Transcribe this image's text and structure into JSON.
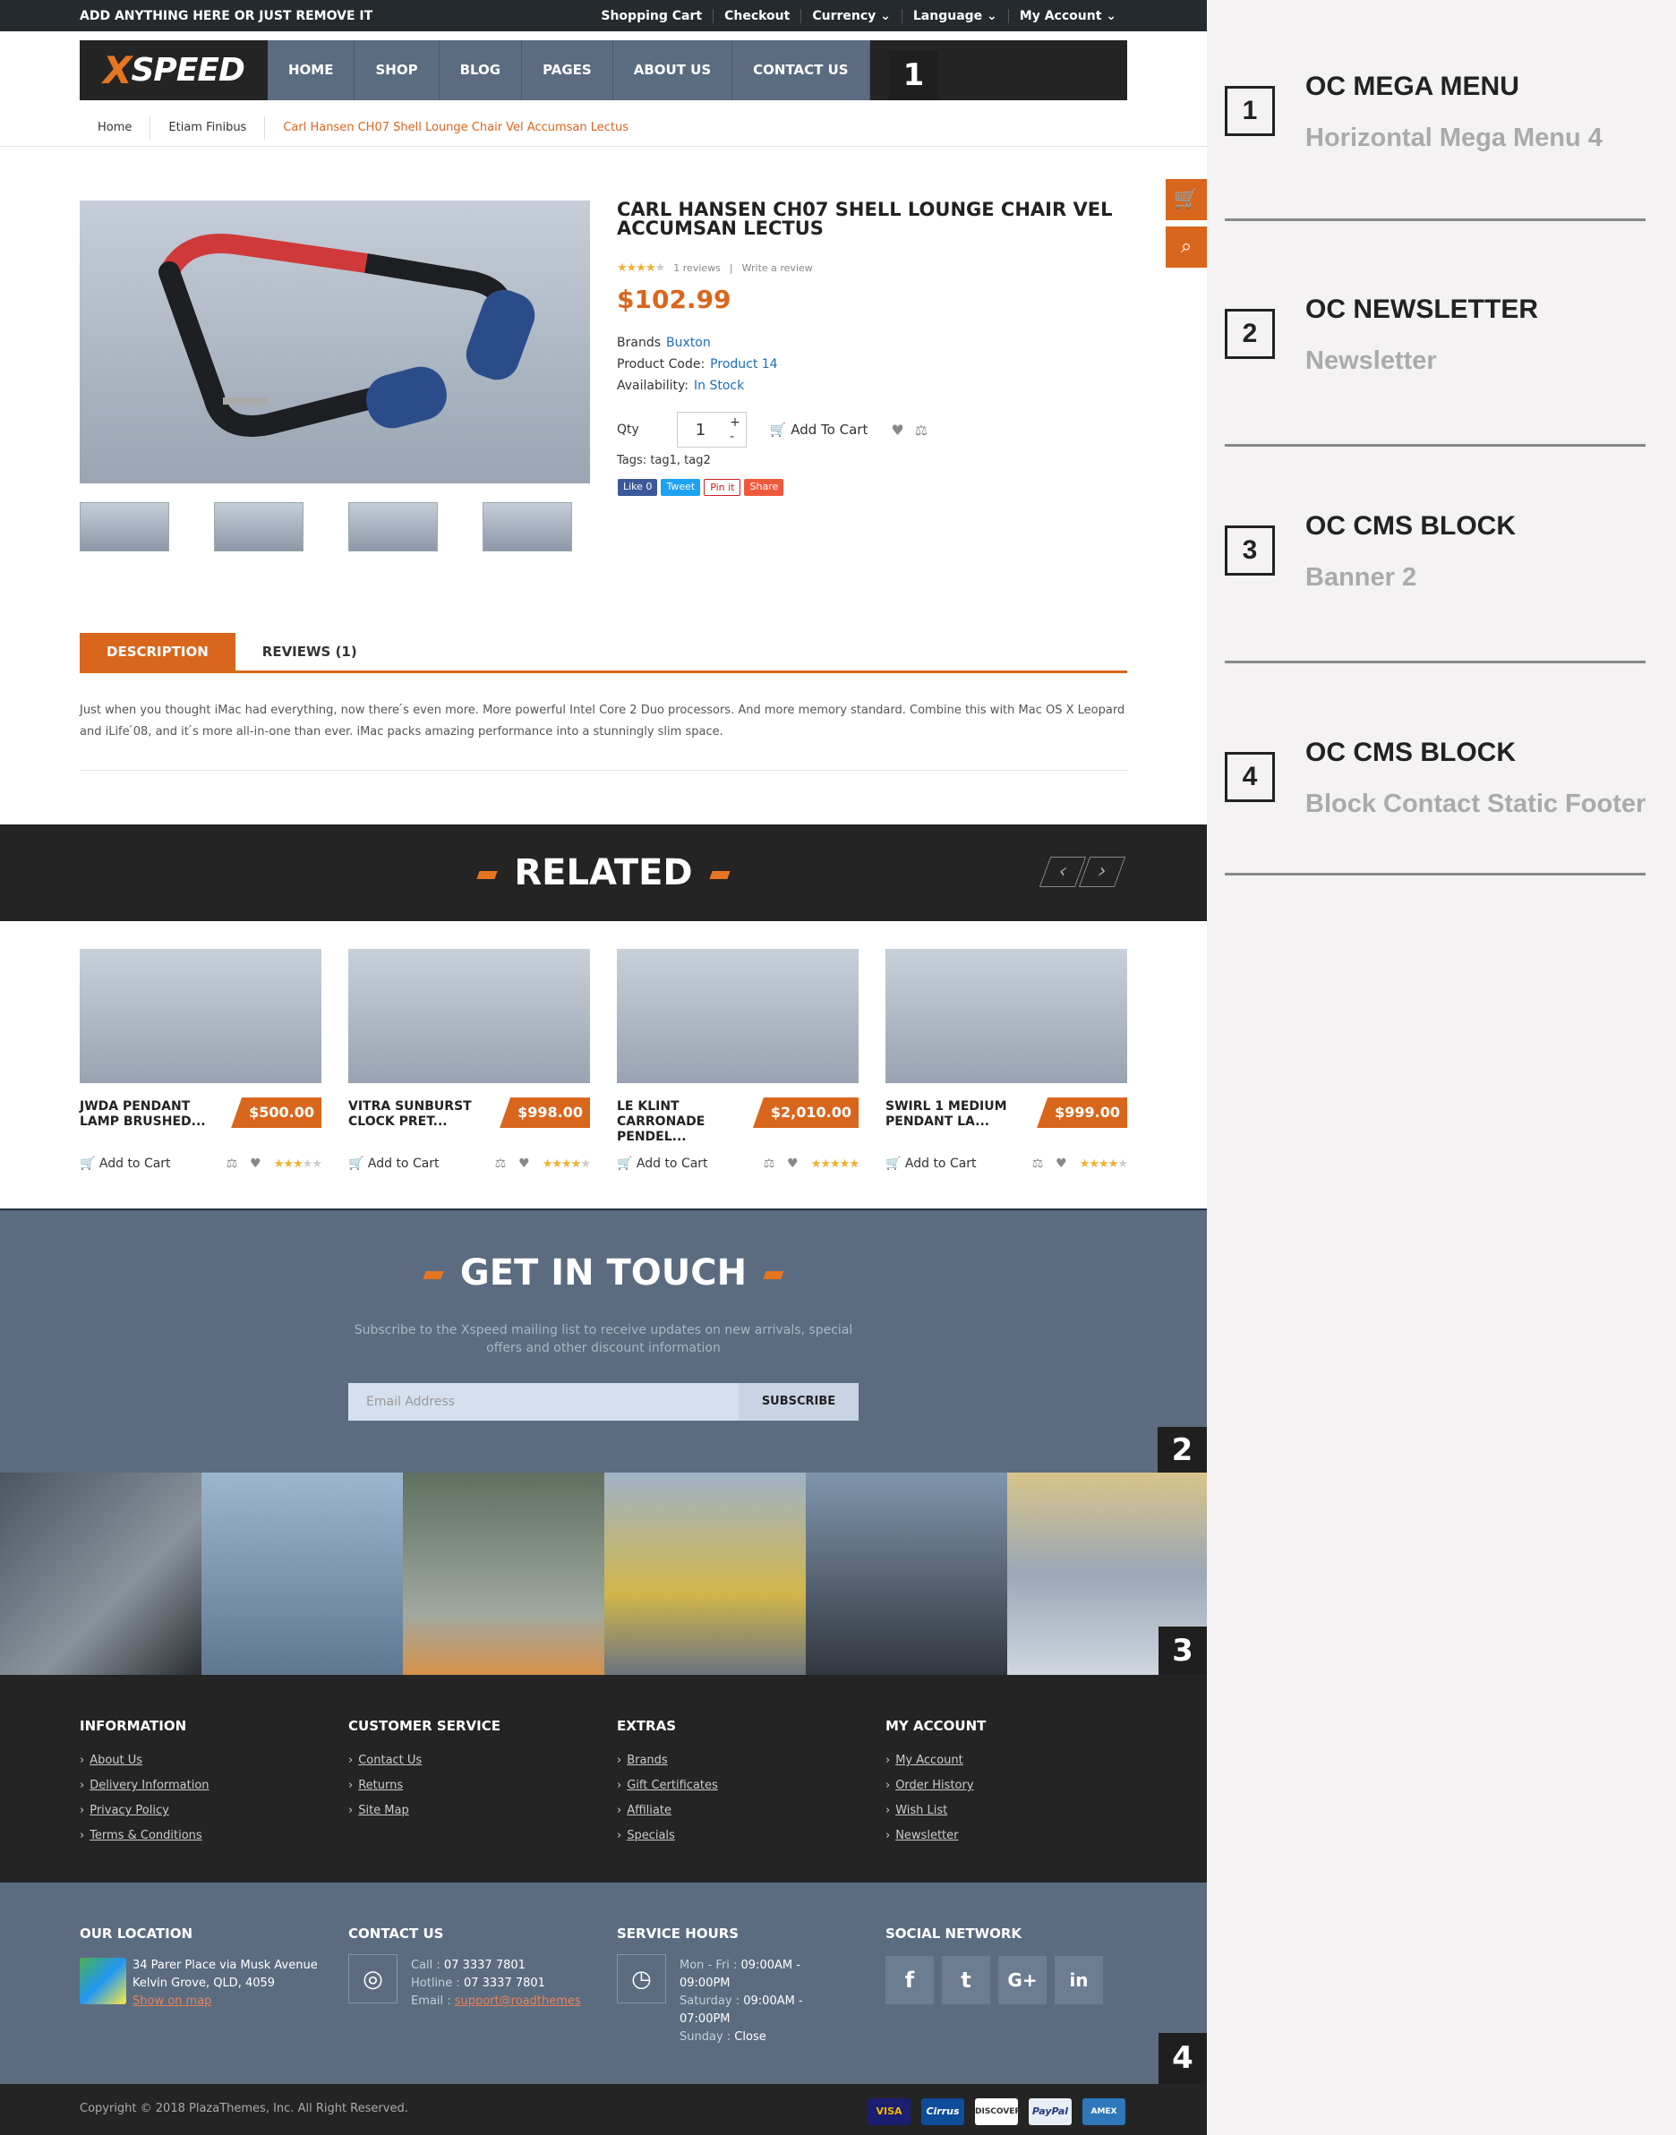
{
  "topbar": {
    "promo": "ADD ANYTHING HERE OR JUST REMOVE IT",
    "links": [
      "Shopping Cart",
      "Checkout",
      "Currency ⌄",
      "Language ⌄",
      "My Account ⌄"
    ]
  },
  "header": {
    "logo": "SPEED",
    "logo_x": "X",
    "nav": [
      "HOME",
      "SHOP",
      "BLOG",
      "PAGES",
      "ABOUT US",
      "CONTACT US"
    ]
  },
  "badges": [
    "1",
    "2",
    "3",
    "4"
  ],
  "breadcrumb": [
    "Home",
    "Etiam Finibus",
    "Carl Hansen CH07 Shell Lounge Chair Vel Accumsan Lectus"
  ],
  "product": {
    "title": "CARL HANSEN CH07 SHELL LOUNGE CHAIR VEL ACCUMSAN LECTUS",
    "reviews": "1 reviews",
    "write_review": "Write a review",
    "rating": 4,
    "price": "$102.99",
    "brand_label": "Brands",
    "brand": "Buxton",
    "code_label": "Product Code:",
    "code": "Product 14",
    "avail_label": "Availability:",
    "avail": "In Stock",
    "qty_label": "Qty",
    "qty": "1",
    "add_to_cart": "Add To Cart",
    "tags_label": "Tags:",
    "tags": "tag1, tag2",
    "share": [
      "Like 0",
      "Tweet",
      "Pin it",
      "Share"
    ]
  },
  "tabs": [
    "DESCRIPTION",
    "REVIEWS (1)"
  ],
  "description": "Just when you thought iMac had everything, now there ́s even more. More powerful Intel Core 2 Duo processors. And more memory standard. Combine this with Mac OS X Leopard and iLife ́08, and it ́s more all-in-one than ever. iMac packs amazing performance into a stunningly slim space.",
  "related": {
    "title": "RELATED",
    "items": [
      {
        "name": "JWDA PENDANT LAMP BRUSHED...",
        "price": "$500.00",
        "rating": 3
      },
      {
        "name": "VITRA SUNBURST CLOCK PRET...",
        "price": "$998.00",
        "rating": 4
      },
      {
        "name": "LE KLINT CARRONADE PENDEL...",
        "price": "$2,010.00",
        "rating": 5
      },
      {
        "name": "SWIRL 1 MEDIUM PENDANT LA...",
        "price": "$999.00",
        "rating": 4
      }
    ],
    "add_to_cart": "Add to Cart"
  },
  "newsletter": {
    "title": "GET IN TOUCH",
    "subtitle": "Subscribe to the Xspeed mailing list to receive updates on new arrivals, special offers and other discount information",
    "placeholder": "Email Address",
    "button": "SUBSCRIBE"
  },
  "footer": {
    "columns": [
      {
        "title": "INFORMATION",
        "links": [
          "About Us",
          "Delivery Information",
          "Privacy Policy",
          "Terms & Conditions"
        ]
      },
      {
        "title": "CUSTOMER SERVICE",
        "links": [
          "Contact Us",
          "Returns",
          "Site Map"
        ]
      },
      {
        "title": "EXTRAS",
        "links": [
          "Brands",
          "Gift Certificates",
          "Affiliate",
          "Specials"
        ]
      },
      {
        "title": "MY ACCOUNT",
        "links": [
          "My Account",
          "Order History",
          "Wish List",
          "Newsletter"
        ]
      }
    ],
    "location": {
      "title": "OUR LOCATION",
      "line1": "34 Parer Place via Musk Avenue",
      "line2": "Kelvin Grove, QLD, 4059",
      "map": "Show on map"
    },
    "contact": {
      "title": "CONTACT US",
      "call_label": "Call :",
      "call": "07 3337 7801",
      "hotline_label": "Hotline :",
      "hotline": "07 3337 7801",
      "email_label": "Email :",
      "email": "support@roadthemes"
    },
    "hours": {
      "title": "SERVICE HOURS",
      "l1": "Mon - Fri :",
      "v1": "09:00AM -",
      "v1b": "09:00PM",
      "l2": "Saturday :",
      "v2": "09:00AM -",
      "v2b": "07:00PM",
      "l3": "Sunday :",
      "v3": "Close"
    },
    "social": {
      "title": "SOCIAL NETWORK"
    },
    "copyright": "Copyright © 2018 PlazaThemes, Inc. All Right Reserved.",
    "payments": [
      "VISA",
      "Cirrus",
      "DISCOVER",
      "PayPal",
      "AMEX"
    ]
  },
  "sidebar": [
    {
      "num": "1",
      "title": "OC MEGA MENU",
      "sub": "Horizontal Mega Menu 4"
    },
    {
      "num": "2",
      "title": "OC NEWSLETTER",
      "sub": "Newsletter"
    },
    {
      "num": "3",
      "title": "OC CMS BLOCK",
      "sub": "Banner 2"
    },
    {
      "num": "4",
      "title": "OC CMS BLOCK",
      "sub": "Block Contact Static Footer"
    }
  ],
  "colors": {
    "accent": "#d9661d",
    "dark": "#242424",
    "slate": "#5b6c80",
    "link": "#1a6fb8"
  }
}
